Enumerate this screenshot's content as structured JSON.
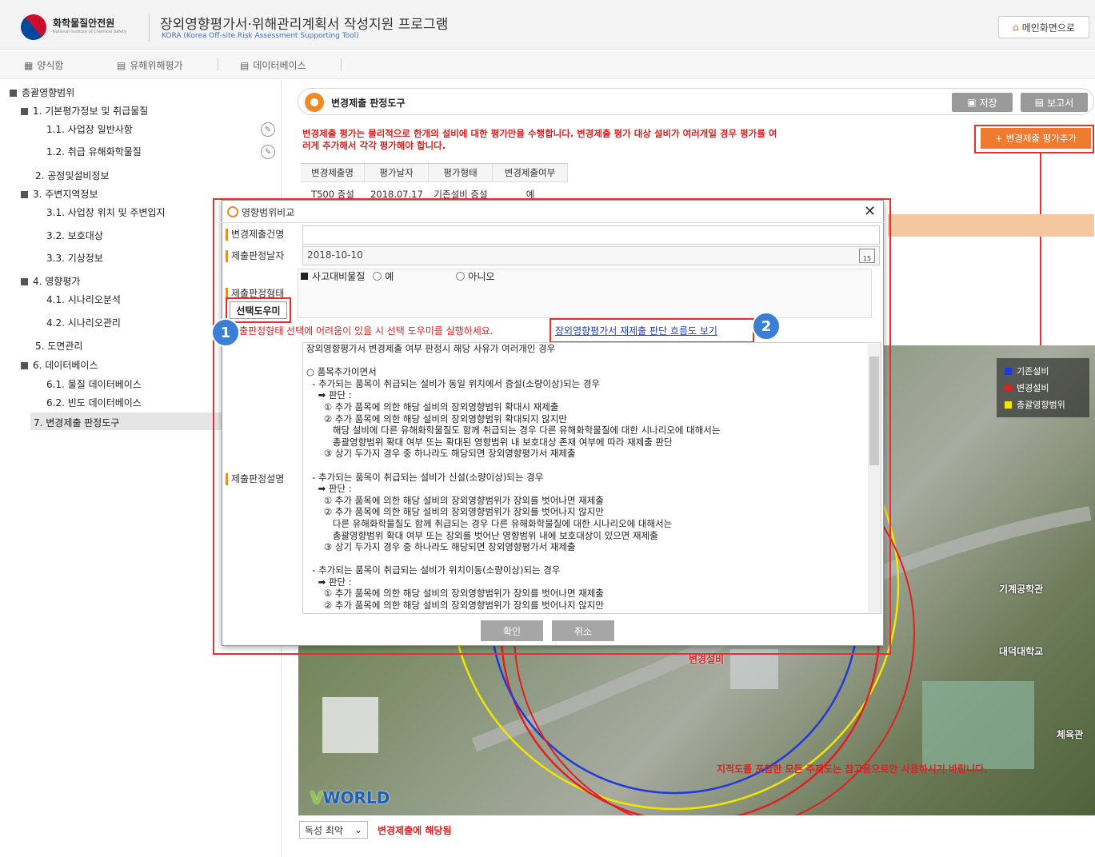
{
  "header": {
    "org_name": "화학물질안전원",
    "org_sub": "National Institute of Chemical Safety",
    "title": "장외영향평가서·위해관리계획서 작성지원 프로그램",
    "subtitle": "KORA (Korea Off-site Risk Assessment Supporting Tool)",
    "home_button": "메인화면으로"
  },
  "menubar": [
    {
      "label": "양식함",
      "icon": "grid-icon"
    },
    {
      "label": "유해위해평가",
      "icon": "list-icon"
    },
    {
      "label": "데이터베이스",
      "icon": "database-icon"
    }
  ],
  "sidebar": {
    "items": [
      {
        "label": "총괄영향범위"
      },
      {
        "label": "1. 기본평가정보 및 취급물질"
      },
      {
        "label": "1.1. 사업장 일반사항"
      },
      {
        "label": "1.2. 취급 유해화학물질"
      },
      {
        "label": "2. 공정및설비정보"
      },
      {
        "label": "3. 주변지역정보"
      },
      {
        "label": "3.1. 사업장 위치 및 주변입지"
      },
      {
        "label": "3.2. 보호대상"
      },
      {
        "label": "3.3. 기상정보"
      },
      {
        "label": "4. 영향평가"
      },
      {
        "label": "4.1. 시나리오분석"
      },
      {
        "label": "4.2. 시나리오관리"
      },
      {
        "label": "5. 도면관리"
      },
      {
        "label": "6. 데이터베이스"
      },
      {
        "label": "6.1. 물질 데이터베이스"
      },
      {
        "label": "6.2. 빈도 데이터베이스"
      },
      {
        "label": "7. 변경제출 판정도구"
      }
    ]
  },
  "tool": {
    "title": "변경제출 판정도구",
    "save_button": "저장",
    "report_button": "보고서",
    "notice": "변경제출 평가는 물리적으로 한개의 설비에 대한 평가만을 수행합니다. 변경제출 평가 대상 설비가 여러개일 경우 평가를 여러게 추가해서 각각 평가해야 합니다.",
    "add_button": "변경제출 평가추가",
    "table": {
      "headers": [
        "변경제출명",
        "평가날자",
        "평가형태",
        "변경제출여부"
      ],
      "row": [
        "T500 증설",
        "2018.07.17",
        "기존설비 증설",
        "예"
      ]
    }
  },
  "map": {
    "legend": [
      {
        "label": "기존설비",
        "color": "#1f3ad8"
      },
      {
        "label": "변경설비",
        "color": "#e02020"
      },
      {
        "label": "총괄영향범위",
        "color": "#f2e600"
      }
    ],
    "labels": [
      "기계공학관",
      "대덕대학교",
      "변경설비",
      "체육관"
    ],
    "footer_notice": "지적도를 포함한 모든 주제도는 참고용으로만 사용하시기 바랍니다.",
    "brand_prefix": "V",
    "brand_suffix": "WORLD"
  },
  "bottom": {
    "select_value": "독성 최악",
    "status": "변경제출에 해당됨"
  },
  "dialog": {
    "title": "영향범위비교",
    "fields": {
      "name_label": "변경제출건명",
      "name_value": "",
      "date_label": "제출판정날자",
      "date_value": "2018-10-10",
      "type_label": "제출판정형태",
      "desc_label": "제출판정설명"
    },
    "accident_label": "사고대비물질",
    "radio_yes": "예",
    "radio_no": "아니오",
    "wizard_button": "선택도우미",
    "wizard_note": "제출판정형태 선택에 어려움이 있을 시 선택 도우미를 실행하세요.",
    "flow_link": "장외영향평가서 재제출 판단 흐름도 보기",
    "badge1": "1",
    "badge2": "2",
    "description": "장외영향평가서 변경제출 여부 판정시 해당 사유가 여러개인 경우\n\n○ 품목추가이면서\n  - 추가되는 품목이 취급되는 설비가 동일 위치에서 증설(소량이상)되는 경우\n    ➡ 판단 :\n      ① 추가 품목에 의한 해당 설비의 장외영향범위 확대시 재제출\n      ② 추가 품목에 의한 해당 설비의 장외영향범위 확대되지 않지만\n         해당 설비에 다른 유해화학물질도 함께 취급되는 경우 다른 유해화학물질에 대한 시나리오에 대해서는\n         총괄영향범위 확대 여부 또는 확대된 영향범위 내 보호대상 존재 여부에 따라 재제출 판단\n      ③ 상기 두가지 경우 중 하나라도 해당되면 장외영향평가서 재제출\n\n  - 추가되는 품목이 취급되는 설비가 신설(소량이상)되는 경우\n    ➡ 판단 :\n      ① 추가 품목에 의한 해당 설비의 장외영향범위가 장외를 벗어나면 재제출\n      ② 추가 품목에 의한 해당 설비의 장외영향범위가 장외를 벗어나지 않지만\n         다른 유해화학물질도 함께 취급되는 경우 다른 유해화학물질에 대한 시나리오에 대해서는\n         총괄영향범위 확대 여부 또는 장외를 벗어난 영향범위 내에 보호대상이 있으면 재제출\n      ③ 상기 두가지 경우 중 하나라도 해당되면 장외영향평가서 재제출\n\n  - 추가되는 품목이 취급되는 설비가 위치이동(소량이상)되는 경우\n    ➡ 판단 :\n      ① 추가 품목에 의한 해당 설비의 장외영향범위가 장외를 벗어나면 재제출\n      ② 추가 품목에 의한 해당 설비의 장외영향범위가 장외를 벗어나지 않지만",
    "ok_button": "확인",
    "cancel_button": "취소"
  }
}
